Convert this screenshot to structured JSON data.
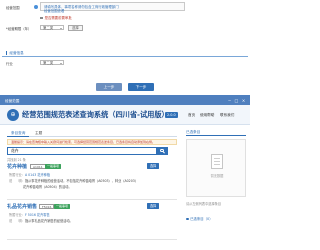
{
  "form": {
    "row1_label": "经营范围",
    "hint_line1": "请填写具体，事项名称请勿包含工商行政管理部门",
    "hint_line2": "经营范围查看",
    "check_text": "是否需要前置审批",
    "row2_label": "*经营期限（年）",
    "row2_sublabel": "经营期限开始",
    "mini_btn": "选择",
    "section_title": "经营信息",
    "select_label": "行业",
    "select_value": "第二类",
    "select2_value": "第二类",
    "prev_button": "上一步",
    "next_button": "下一步"
  },
  "modal": {
    "title": "经营范围",
    "close_glyph": "×",
    "max_glyph": "□",
    "min_glyph": "−"
  },
  "system": {
    "logo_glyph": "⊕",
    "title": "经营范围规范表述查询系统（四川省-试用版）",
    "version": "2.0.0",
    "nav": [
      "首页",
      "使用帮助",
      "联系我们"
    ]
  },
  "tabs": [
    "条目查询",
    "主题"
  ],
  "notice": "温馨提示：请在查询框中输入关键词进行检索，可选择经营范围规范表述条目，已选条目将自动添加到右侧。",
  "search": {
    "value": "花卉",
    "placeholder": "请输入关键词"
  },
  "result_count": "共找到 21 条",
  "results": [
    {
      "name": "花卉种植",
      "code": "A1011",
      "badge": "一般事项",
      "select": "选择",
      "category_label": "所属行业：",
      "category": "A 0143 花卉种植",
      "desc_label": "说　　明：",
      "desc": "指从事花卉种植的经营活动，不包括花卉种苗培育（A0503）、林业（A0203）",
      "desc2": "花卉种苗培育（A0504）的活动。"
    },
    {
      "name": "礼品花卉销售",
      "code": "F5016",
      "badge": "一般事项",
      "select": "选择",
      "category_label": "所属行业：",
      "category": "F 5016 花卉零售",
      "desc_label": "说　　明：",
      "desc": "指从事礼品花卉销售的经营活动。",
      "desc2": ""
    }
  ],
  "right_panel": {
    "header": "已选条目",
    "empty": "暂无数据",
    "hint": "请从左侧列表中选择条目",
    "link": "已选条目（0）"
  },
  "colors": {
    "accent": "#2f6fb6",
    "titlebar": "#4f7fbe",
    "badge_green": "#3da35d",
    "prev_btn": "#6c8fbf",
    "next_btn": "#2f6fb6"
  }
}
